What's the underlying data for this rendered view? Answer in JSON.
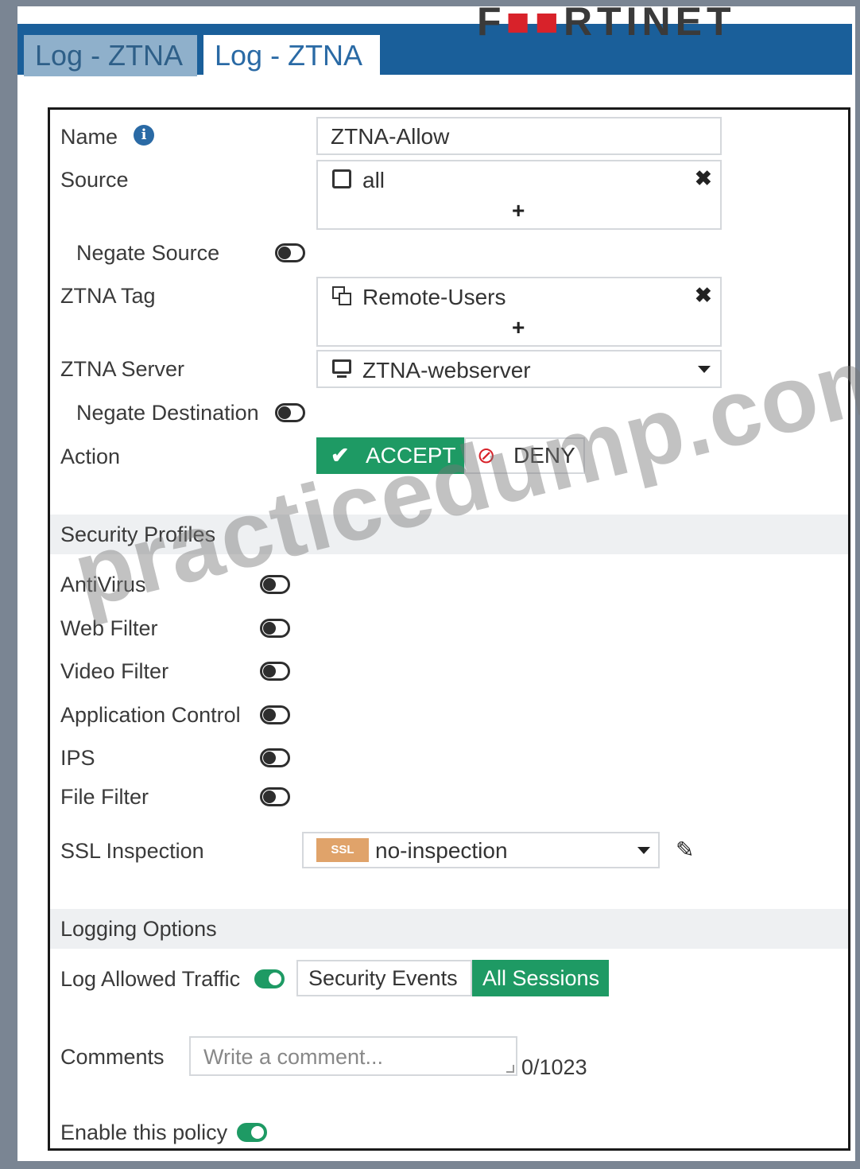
{
  "brand": "FORTINET",
  "tabs": [
    "Log - ZTNA",
    "Log - ZTNA"
  ],
  "form": {
    "name_label": "Name",
    "name_value": "ZTNA-Allow",
    "source_label": "Source",
    "source_value": "all",
    "negate_source_label": "Negate Source",
    "ztna_tag_label": "ZTNA Tag",
    "ztna_tag_value": "Remote-Users",
    "ztna_server_label": "ZTNA Server",
    "ztna_server_value": "ZTNA-webserver",
    "negate_destination_label": "Negate Destination",
    "action_label": "Action",
    "accept_label": "ACCEPT",
    "deny_label": "DENY"
  },
  "security_profiles": {
    "title": "Security Profiles",
    "items": [
      "AntiVirus",
      "Web Filter",
      "Video Filter",
      "Application Control",
      "IPS",
      "File Filter"
    ],
    "ssl_label": "SSL Inspection",
    "ssl_badge": "SSL",
    "ssl_value": "no-inspection"
  },
  "logging": {
    "title": "Logging Options",
    "log_allowed_label": "Log Allowed Traffic",
    "security_events": "Security Events",
    "all_sessions": "All Sessions"
  },
  "comments": {
    "label": "Comments",
    "placeholder": "Write a comment...",
    "counter": "0/1023"
  },
  "enable_label": "Enable this policy",
  "watermark": "practicedump.com",
  "colors": {
    "header_blue": "#1a5f9a",
    "accept_green": "#1e9a64",
    "ssl_orange": "#e0a36a",
    "deny_red": "#d8222a"
  }
}
